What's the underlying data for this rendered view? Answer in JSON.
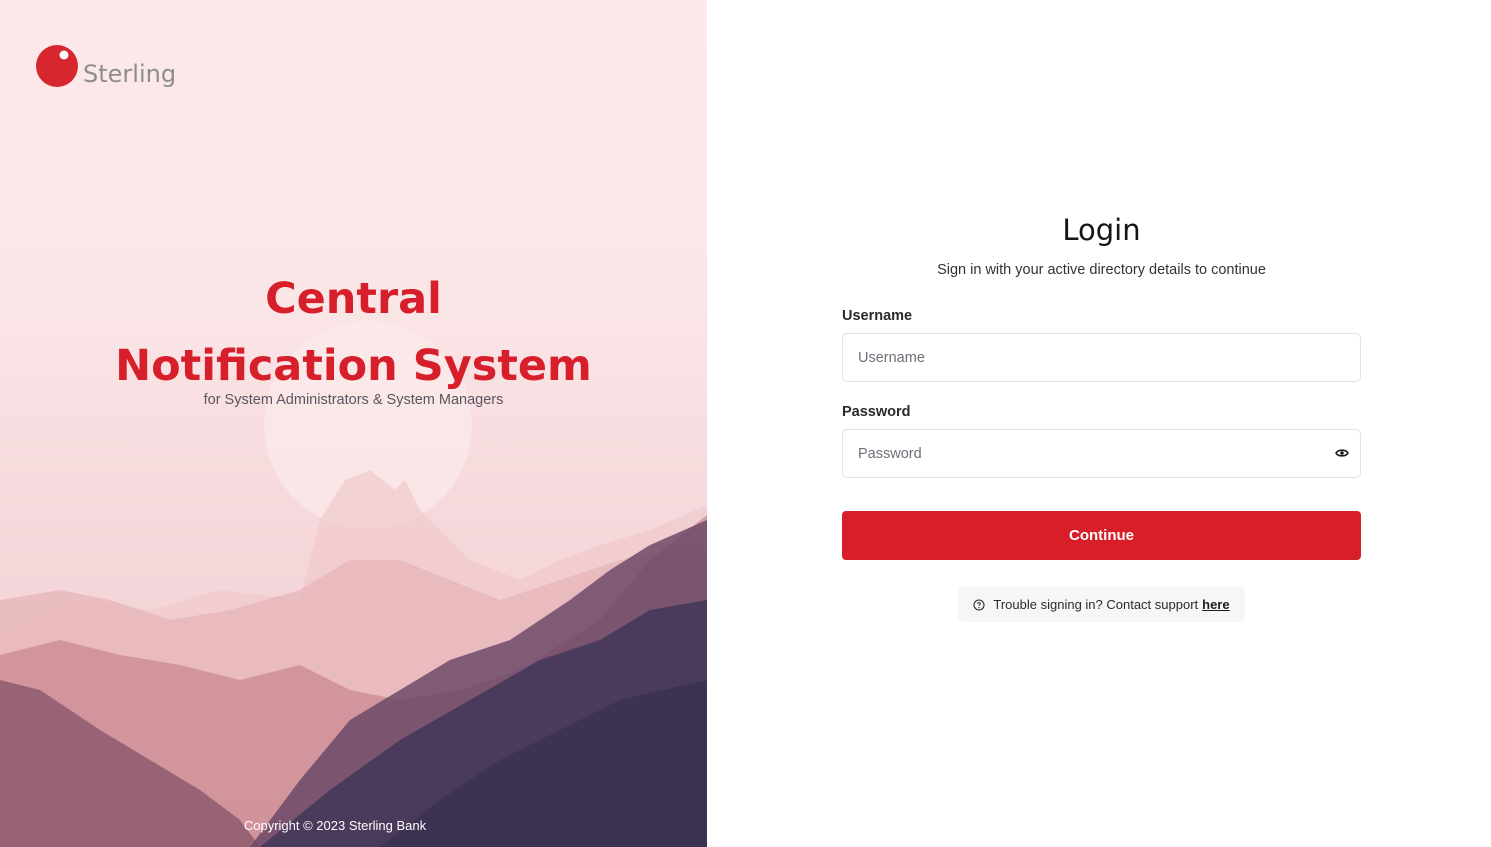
{
  "brand": {
    "name": "Sterling",
    "logo_icon": "sterling-logo-icon",
    "accent_color": "#d81f29"
  },
  "hero": {
    "title_line1": "Central",
    "title_line2": "Notification System",
    "subtitle": "for System Administrators & System Managers",
    "copyright": "Copyright © 2023 Sterling Bank"
  },
  "login": {
    "title": "Login",
    "subtitle": "Sign in with your active directory details to continue",
    "username": {
      "label": "Username",
      "placeholder": "Username",
      "value": ""
    },
    "password": {
      "label": "Password",
      "placeholder": "Password",
      "value": "",
      "toggle_icon": "eye-icon"
    },
    "continue_label": "Continue",
    "help": {
      "icon": "help-circle-icon",
      "text": "Trouble signing in? Contact support",
      "link_text": "here"
    }
  }
}
